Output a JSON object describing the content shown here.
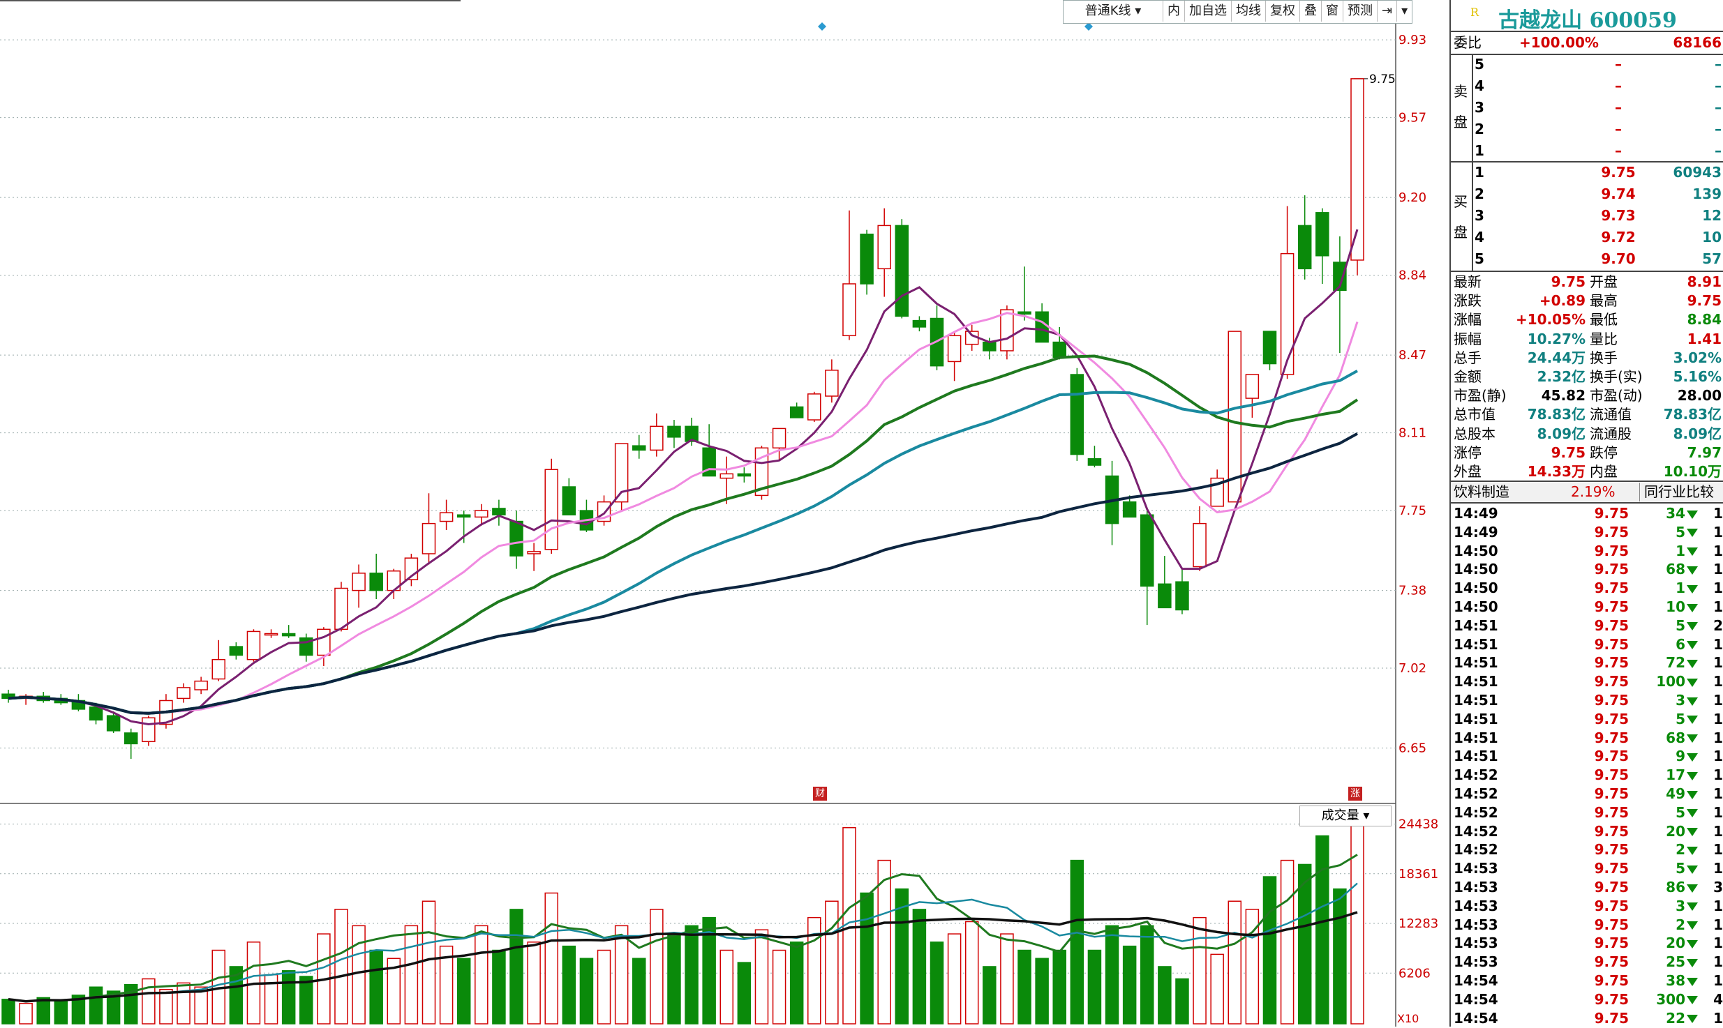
{
  "toolbar": {
    "kline_type": "普通K线",
    "items": [
      "内",
      "加自选",
      "均线",
      "复权",
      "叠",
      "窗",
      "预测"
    ]
  },
  "stock": {
    "name": "古越龙山",
    "code": "600059",
    "r_badge": "R"
  },
  "price_axis": {
    "labels": [
      "9.93",
      "9.57",
      "9.20",
      "8.84",
      "8.47",
      "8.11",
      "7.75",
      "7.38",
      "7.02",
      "6.65"
    ],
    "last": "9.75"
  },
  "volume": {
    "dropdown": "成交量",
    "axis": [
      "24438",
      "18361",
      "12283",
      "6206"
    ],
    "unit": "X10"
  },
  "markers": {
    "cai": "财",
    "zhang": "涨"
  },
  "order": {
    "weibi_label": "委比",
    "weibi_pct": "+100.00%",
    "weibi_vol": "68166",
    "sell_label": [
      "卖",
      "盘"
    ],
    "buy_label": [
      "买",
      "盘"
    ],
    "sells": [
      {
        "lvl": "5",
        "p": "–",
        "v": "–"
      },
      {
        "lvl": "4",
        "p": "–",
        "v": "–"
      },
      {
        "lvl": "3",
        "p": "–",
        "v": "–"
      },
      {
        "lvl": "2",
        "p": "–",
        "v": "–"
      },
      {
        "lvl": "1",
        "p": "–",
        "v": "–"
      }
    ],
    "buys": [
      {
        "lvl": "1",
        "p": "9.75",
        "v": "60943"
      },
      {
        "lvl": "2",
        "p": "9.74",
        "v": "139"
      },
      {
        "lvl": "3",
        "p": "9.73",
        "v": "12"
      },
      {
        "lvl": "4",
        "p": "9.72",
        "v": "10"
      },
      {
        "lvl": "5",
        "p": "9.70",
        "v": "57"
      }
    ]
  },
  "quote": [
    {
      "l1": "最新",
      "v1": "9.75",
      "c1": "red",
      "l2": "开盘",
      "v2": "8.91",
      "c2": "red"
    },
    {
      "l1": "涨跌",
      "v1": "+0.89",
      "c1": "red",
      "l2": "最高",
      "v2": "9.75",
      "c2": "red"
    },
    {
      "l1": "涨幅",
      "v1": "+10.05%",
      "c1": "red",
      "l2": "最低",
      "v2": "8.84",
      "c2": "green"
    },
    {
      "l1": "振幅",
      "v1": "10.27%",
      "c1": "teal",
      "l2": "量比",
      "v2": "1.41",
      "c2": "red"
    },
    {
      "l1": "总手",
      "v1": "24.44万",
      "c1": "teal",
      "l2": "换手",
      "v2": "3.02%",
      "c2": "teal"
    },
    {
      "l1": "金额",
      "v1": "2.32亿",
      "c1": "teal",
      "l2": "换手(实)",
      "v2": "5.16%",
      "c2": "teal"
    },
    {
      "l1": "市盈(静)",
      "v1": "45.82",
      "c1": "black",
      "l2": "市盈(动)",
      "v2": "28.00",
      "c2": "black"
    },
    {
      "l1": "总市值",
      "v1": "78.83亿",
      "c1": "teal",
      "l2": "流通值",
      "v2": "78.83亿",
      "c2": "teal"
    },
    {
      "l1": "总股本",
      "v1": "8.09亿",
      "c1": "teal",
      "l2": "流通股",
      "v2": "8.09亿",
      "c2": "teal"
    },
    {
      "l1": "涨停",
      "v1": "9.75",
      "c1": "red",
      "l2": "跌停",
      "v2": "7.97",
      "c2": "green"
    },
    {
      "l1": "外盘",
      "v1": "14.33万",
      "c1": "red",
      "l2": "内盘",
      "v2": "10.10万",
      "c2": "green"
    }
  ],
  "industry": {
    "name": "饮料制造",
    "pct": "2.19%",
    "compare": "同行业比较"
  },
  "trades": [
    {
      "t": "14:49",
      "p": "9.75",
      "v": "34",
      "n": "1"
    },
    {
      "t": "14:49",
      "p": "9.75",
      "v": "5",
      "n": "1"
    },
    {
      "t": "14:50",
      "p": "9.75",
      "v": "1",
      "n": "1"
    },
    {
      "t": "14:50",
      "p": "9.75",
      "v": "68",
      "n": "1"
    },
    {
      "t": "14:50",
      "p": "9.75",
      "v": "1",
      "n": "1"
    },
    {
      "t": "14:50",
      "p": "9.75",
      "v": "10",
      "n": "1"
    },
    {
      "t": "14:51",
      "p": "9.75",
      "v": "5",
      "n": "2"
    },
    {
      "t": "14:51",
      "p": "9.75",
      "v": "6",
      "n": "1"
    },
    {
      "t": "14:51",
      "p": "9.75",
      "v": "72",
      "n": "1"
    },
    {
      "t": "14:51",
      "p": "9.75",
      "v": "100",
      "n": "1"
    },
    {
      "t": "14:51",
      "p": "9.75",
      "v": "3",
      "n": "1"
    },
    {
      "t": "14:51",
      "p": "9.75",
      "v": "5",
      "n": "1"
    },
    {
      "t": "14:51",
      "p": "9.75",
      "v": "68",
      "n": "1"
    },
    {
      "t": "14:51",
      "p": "9.75",
      "v": "9",
      "n": "1"
    },
    {
      "t": "14:52",
      "p": "9.75",
      "v": "17",
      "n": "1"
    },
    {
      "t": "14:52",
      "p": "9.75",
      "v": "49",
      "n": "1"
    },
    {
      "t": "14:52",
      "p": "9.75",
      "v": "5",
      "n": "1"
    },
    {
      "t": "14:52",
      "p": "9.75",
      "v": "20",
      "n": "1"
    },
    {
      "t": "14:52",
      "p": "9.75",
      "v": "2",
      "n": "1"
    },
    {
      "t": "14:53",
      "p": "9.75",
      "v": "5",
      "n": "1"
    },
    {
      "t": "14:53",
      "p": "9.75",
      "v": "86",
      "n": "3"
    },
    {
      "t": "14:53",
      "p": "9.75",
      "v": "3",
      "n": "1"
    },
    {
      "t": "14:53",
      "p": "9.75",
      "v": "2",
      "n": "1"
    },
    {
      "t": "14:53",
      "p": "9.75",
      "v": "20",
      "n": "1"
    },
    {
      "t": "14:53",
      "p": "9.75",
      "v": "25",
      "n": "1"
    },
    {
      "t": "14:54",
      "p": "9.75",
      "v": "38",
      "n": "1"
    },
    {
      "t": "14:54",
      "p": "9.75",
      "v": "300",
      "n": "4"
    },
    {
      "t": "14:54",
      "p": "9.75",
      "v": "22",
      "n": "1"
    }
  ],
  "chart_data": {
    "type": "candlestick",
    "price_range": [
      6.4,
      10.05
    ],
    "volume_range": [
      0,
      25000
    ],
    "candles": [
      [
        6.9,
        6.92,
        6.86,
        6.88,
        3000
      ],
      [
        6.88,
        6.9,
        6.85,
        6.89,
        2500
      ],
      [
        6.89,
        6.91,
        6.86,
        6.87,
        3200
      ],
      [
        6.88,
        6.9,
        6.85,
        6.86,
        2800
      ],
      [
        6.87,
        6.9,
        6.82,
        6.83,
        3500
      ],
      [
        6.84,
        6.86,
        6.76,
        6.78,
        4500
      ],
      [
        6.8,
        6.82,
        6.72,
        6.73,
        4000
      ],
      [
        6.72,
        6.74,
        6.6,
        6.67,
        4800
      ],
      [
        6.68,
        6.8,
        6.66,
        6.79,
        5500
      ],
      [
        6.76,
        6.9,
        6.74,
        6.87,
        4200
      ],
      [
        6.88,
        6.95,
        6.86,
        6.93,
        5000
      ],
      [
        6.92,
        6.98,
        6.9,
        6.96,
        4500
      ],
      [
        6.97,
        7.15,
        6.96,
        7.06,
        9000
      ],
      [
        7.12,
        7.14,
        7.06,
        7.08,
        7000
      ],
      [
        7.06,
        7.2,
        7.05,
        7.19,
        10000
      ],
      [
        7.18,
        7.2,
        7.16,
        7.18,
        6000
      ],
      [
        7.18,
        7.22,
        7.16,
        7.17,
        6500
      ],
      [
        7.16,
        7.18,
        7.05,
        7.08,
        5800
      ],
      [
        7.08,
        7.21,
        7.03,
        7.2,
        11000
      ],
      [
        7.2,
        7.42,
        7.19,
        7.39,
        14000
      ],
      [
        7.38,
        7.5,
        7.3,
        7.46,
        12000
      ],
      [
        7.46,
        7.55,
        7.34,
        7.38,
        9000
      ],
      [
        7.38,
        7.48,
        7.34,
        7.47,
        8000
      ],
      [
        7.43,
        7.55,
        7.4,
        7.53,
        12000
      ],
      [
        7.55,
        7.83,
        7.5,
        7.69,
        15000
      ],
      [
        7.7,
        7.8,
        7.66,
        7.74,
        9500
      ],
      [
        7.73,
        7.75,
        7.6,
        7.72,
        8000
      ],
      [
        7.72,
        7.78,
        7.68,
        7.75,
        12000
      ],
      [
        7.76,
        7.8,
        7.68,
        7.73,
        9000
      ],
      [
        7.7,
        7.75,
        7.48,
        7.54,
        14000
      ],
      [
        7.55,
        7.6,
        7.47,
        7.56,
        10000
      ],
      [
        7.57,
        7.99,
        7.55,
        7.94,
        16000
      ],
      [
        7.86,
        7.9,
        7.73,
        7.73,
        9500
      ],
      [
        7.75,
        7.8,
        7.65,
        7.66,
        8000
      ],
      [
        7.7,
        7.82,
        7.68,
        7.79,
        9000
      ],
      [
        7.79,
        8.06,
        7.75,
        8.06,
        12000
      ],
      [
        8.05,
        8.1,
        7.99,
        8.03,
        8000
      ],
      [
        8.03,
        8.2,
        8.0,
        8.14,
        14000
      ],
      [
        8.14,
        8.17,
        8.04,
        8.09,
        11000
      ],
      [
        8.14,
        8.18,
        8.05,
        8.07,
        12000
      ],
      [
        8.04,
        8.15,
        7.95,
        7.91,
        13000
      ],
      [
        7.9,
        8.0,
        7.78,
        7.92,
        9000
      ],
      [
        7.92,
        7.95,
        7.88,
        7.91,
        7500
      ],
      [
        7.82,
        8.05,
        7.8,
        8.04,
        11500
      ],
      [
        8.04,
        8.13,
        7.98,
        8.13,
        9000
      ],
      [
        8.23,
        8.25,
        8.18,
        8.18,
        10000
      ],
      [
        8.17,
        8.3,
        8.16,
        8.29,
        13000
      ],
      [
        8.28,
        8.45,
        8.25,
        8.4,
        15000
      ],
      [
        8.56,
        9.14,
        8.54,
        8.8,
        24000
      ],
      [
        9.03,
        9.05,
        8.75,
        8.8,
        16000
      ],
      [
        8.87,
        9.15,
        8.74,
        9.07,
        20000
      ],
      [
        9.07,
        9.1,
        8.64,
        8.65,
        16500
      ],
      [
        8.63,
        8.65,
        8.58,
        8.6,
        14000
      ],
      [
        8.64,
        8.7,
        8.4,
        8.42,
        10000
      ],
      [
        8.44,
        8.58,
        8.35,
        8.56,
        11000
      ],
      [
        8.52,
        8.61,
        8.49,
        8.58,
        12500
      ],
      [
        8.53,
        8.55,
        8.45,
        8.49,
        7000
      ],
      [
        8.49,
        8.7,
        8.45,
        8.68,
        11000
      ],
      [
        8.67,
        8.88,
        8.63,
        8.66,
        9000
      ],
      [
        8.67,
        8.71,
        8.55,
        8.53,
        8000
      ],
      [
        8.53,
        8.6,
        8.45,
        8.46,
        9000
      ],
      [
        8.38,
        8.41,
        7.98,
        8.01,
        20000
      ],
      [
        7.99,
        8.05,
        7.95,
        7.96,
        9000
      ],
      [
        7.91,
        7.98,
        7.59,
        7.69,
        12000
      ],
      [
        7.79,
        7.82,
        7.72,
        7.72,
        9500
      ],
      [
        7.73,
        7.75,
        7.22,
        7.4,
        12000
      ],
      [
        7.41,
        7.54,
        7.32,
        7.3,
        7000
      ],
      [
        7.42,
        7.48,
        7.27,
        7.29,
        5500
      ],
      [
        7.49,
        7.77,
        7.47,
        7.69,
        13000
      ],
      [
        7.77,
        7.94,
        7.77,
        7.9,
        8500
      ],
      [
        7.79,
        8.5,
        7.8,
        8.58,
        15000
      ],
      [
        8.27,
        8.38,
        8.18,
        8.38,
        14000
      ],
      [
        8.58,
        8.56,
        8.4,
        8.43,
        18000
      ],
      [
        8.38,
        9.16,
        8.36,
        8.94,
        20000
      ],
      [
        9.07,
        9.21,
        8.82,
        8.87,
        19500
      ],
      [
        9.13,
        9.15,
        8.8,
        8.93,
        23000
      ],
      [
        8.9,
        9.02,
        8.48,
        8.77,
        16500
      ],
      [
        8.91,
        9.75,
        8.84,
        9.75,
        24438
      ]
    ]
  }
}
